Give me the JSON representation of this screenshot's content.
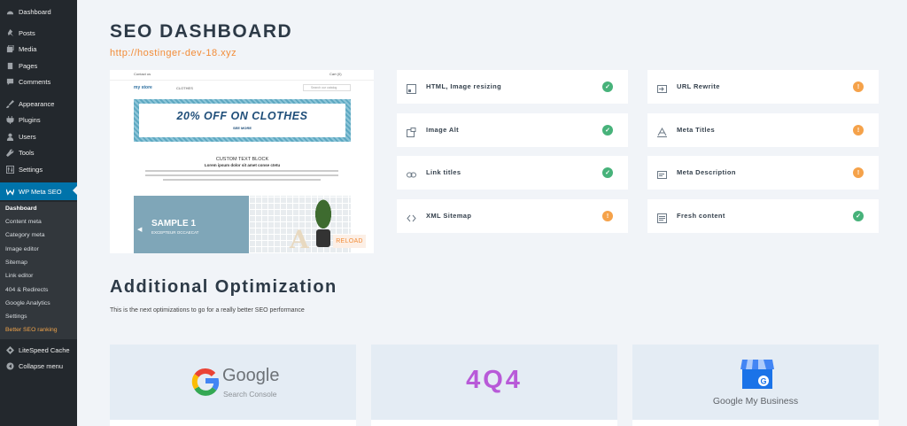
{
  "sidebar": {
    "items": [
      {
        "label": "Dashboard",
        "icon": "dashboard-icon"
      },
      {
        "label": "Posts",
        "icon": "pin-icon"
      },
      {
        "label": "Media",
        "icon": "media-icon"
      },
      {
        "label": "Pages",
        "icon": "pages-icon"
      },
      {
        "label": "Comments",
        "icon": "comment-icon"
      },
      {
        "label": "Appearance",
        "icon": "brush-icon"
      },
      {
        "label": "Plugins",
        "icon": "plugin-icon"
      },
      {
        "label": "Users",
        "icon": "users-icon"
      },
      {
        "label": "Tools",
        "icon": "wrench-icon"
      },
      {
        "label": "Settings",
        "icon": "settings-icon"
      },
      {
        "label": "WP Meta SEO",
        "icon": "seo-icon",
        "active": true
      }
    ],
    "submenu": [
      "Dashboard",
      "Content meta",
      "Category meta",
      "Image editor",
      "Sitemap",
      "Link editor",
      "404 & Redirects",
      "Google Analytics",
      "Settings",
      "Better SEO ranking"
    ],
    "after": [
      {
        "label": "LiteSpeed Cache",
        "icon": "diamond-icon"
      },
      {
        "label": "Collapse menu",
        "icon": "collapse-icon"
      }
    ]
  },
  "header": {
    "title": "SEO DASHBOARD",
    "url": "http://hostinger-dev-18.xyz"
  },
  "preview": {
    "contact": "Contact us",
    "cart": "Cart (0)",
    "logo": "my store",
    "nav": "CLOTHES",
    "search_placeholder": "Search our catalog",
    "banner_text": "20% OFF ON CLOTHES",
    "banner_sub": "SEE MORE",
    "custom_block_title": "CUSTOM TEXT BLOCK",
    "custom_block_sub": "Lorem ipsum dolor sit amet conse ctetu",
    "slide_title": "SAMPLE 1",
    "slide_sub": "EXCEPTEUR OCCAECAT",
    "reload": "RELOAD"
  },
  "checks": {
    "left": [
      {
        "label": "HTML, Image resizing",
        "status": "ok",
        "icon": "image-resize-icon"
      },
      {
        "label": "Image Alt",
        "status": "ok",
        "icon": "image-alt-icon"
      },
      {
        "label": "Link titles",
        "status": "ok",
        "icon": "link-icon"
      },
      {
        "label": "XML Sitemap",
        "status": "warn",
        "icon": "code-icon"
      }
    ],
    "right": [
      {
        "label": "URL Rewrite",
        "status": "warn",
        "icon": "url-rewrite-icon"
      },
      {
        "label": "Meta Titles",
        "status": "warn",
        "icon": "text-a-icon"
      },
      {
        "label": "Meta Description",
        "status": "warn",
        "icon": "description-icon"
      },
      {
        "label": "Fresh content",
        "status": "ok",
        "icon": "content-icon"
      }
    ],
    "ok_glyph": "✓",
    "warn_glyph": "!"
  },
  "additional": {
    "title": "Additional Optimization",
    "subtitle": "This is the next optimizations to go for a really better SEO performance",
    "cards": [
      {
        "name": "Google",
        "sub": "Search Console"
      },
      {
        "name": "4Q4"
      },
      {
        "name": "Google My Business"
      }
    ]
  },
  "colors": {
    "sidebar": "#23282d",
    "active": "#0073aa",
    "accent": "#f28c38",
    "ok": "#47b27a",
    "warn": "#f5a24a"
  }
}
